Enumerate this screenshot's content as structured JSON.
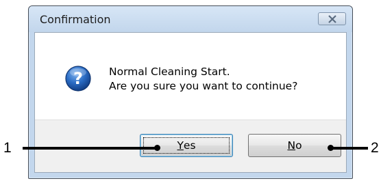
{
  "dialog": {
    "title": "Confirmation",
    "message_line1": "Normal Cleaning Start.",
    "message_line2": "Are you sure you want to continue?",
    "icon": "question-icon",
    "yes_label_prefix": "",
    "yes_label_accel": "Y",
    "yes_label_rest": "es",
    "no_label_accel": "N",
    "no_label_rest": "o"
  },
  "callouts": {
    "left_number": "1",
    "right_number": "2"
  },
  "colors": {
    "icon_blue": "#1e5fb3",
    "title_bar": "#c3d7ed"
  }
}
